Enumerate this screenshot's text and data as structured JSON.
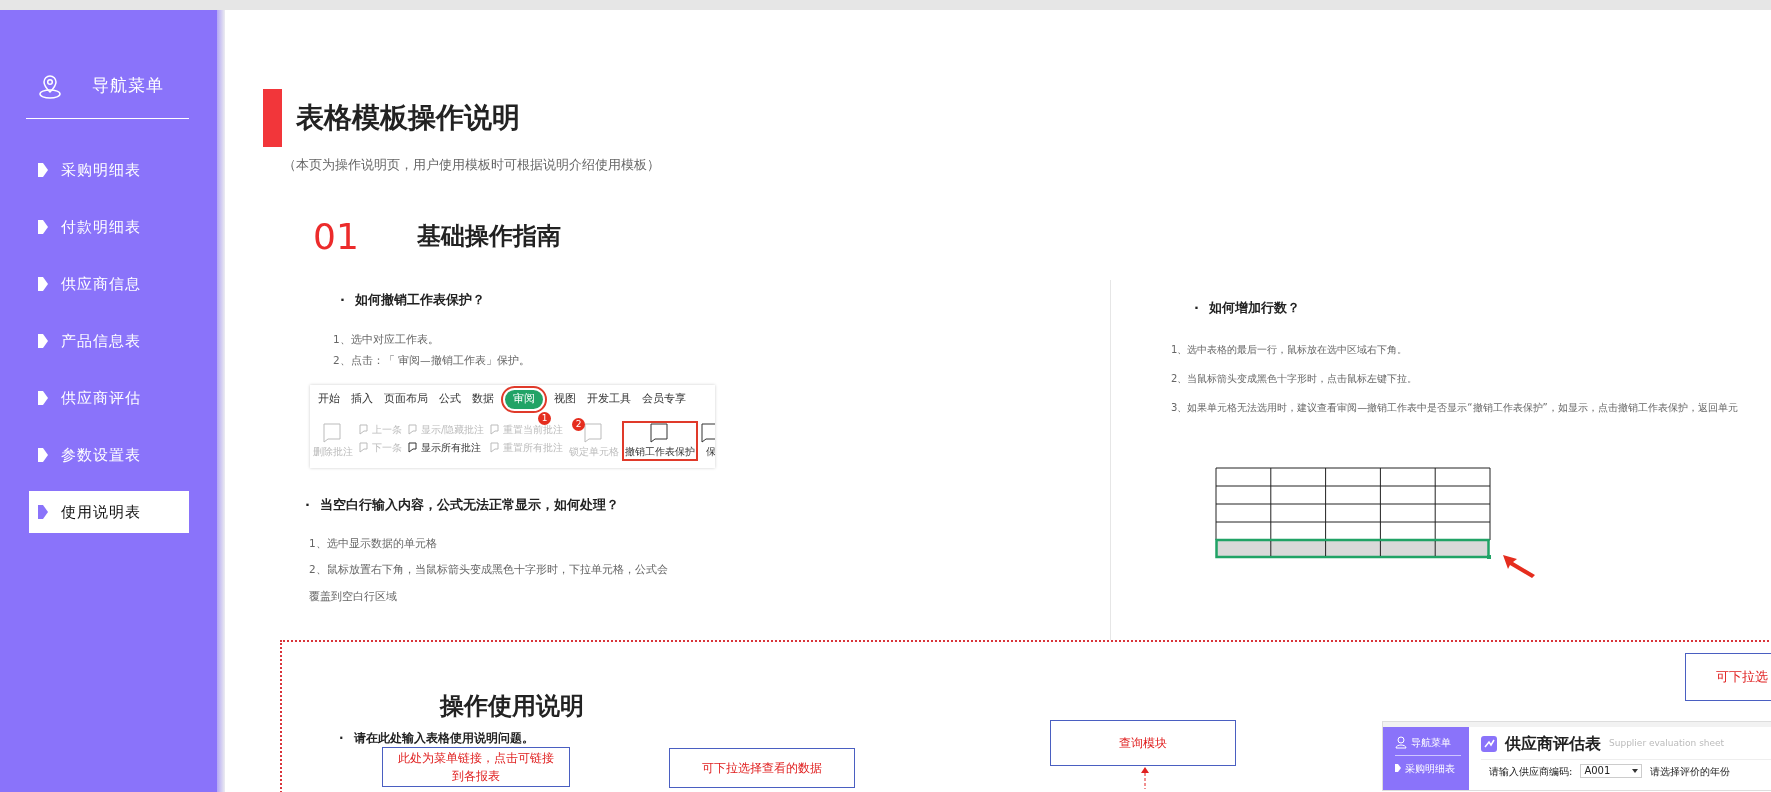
{
  "sidebar": {
    "title": "导航菜单",
    "items": [
      {
        "label": "采购明细表",
        "selected": false
      },
      {
        "label": "付款明细表",
        "selected": false
      },
      {
        "label": "供应商信息",
        "selected": false
      },
      {
        "label": "产品信息表",
        "selected": false
      },
      {
        "label": "供应商评估",
        "selected": false
      },
      {
        "label": "参数设置表",
        "selected": false
      },
      {
        "label": "使用说明表",
        "selected": true
      }
    ]
  },
  "page": {
    "title": "表格模板操作说明",
    "subtitle": "（本页为操作说明页，用户使用模板时可根据说明介绍使用模板）"
  },
  "section": {
    "number": "01",
    "title": "基础操作指南"
  },
  "left_column": {
    "faqs": [
      {
        "bullet": "·",
        "question": "如何撤销工作表保护？",
        "steps": [
          "1、选中对应工作表。",
          "2、点击：「 审阅—撤销工作表」保护。"
        ],
        "kind": "with_toolbar"
      },
      {
        "bullet": "·",
        "question": "当空白行输入内容，公式无法正常显示，如何处理？",
        "steps": [
          "1、选中显示数据的单元格",
          "2、鼠标放置右下角，当鼠标箭头变成黑色十字形时，下拉单元格，公式会覆盖到空白行区域"
        ],
        "kind": "plain"
      }
    ],
    "toolbar_image": {
      "tabs": [
        {
          "label": "开始",
          "selected": false
        },
        {
          "label": "插入",
          "selected": false
        },
        {
          "label": "页面布局",
          "selected": false
        },
        {
          "label": "公式",
          "selected": false
        },
        {
          "label": "数据",
          "selected": false
        },
        {
          "label": "审阅",
          "selected": true
        },
        {
          "label": "视图",
          "selected": false
        },
        {
          "label": "开发工具",
          "selected": false
        },
        {
          "label": "会员专享",
          "selected": false
        }
      ],
      "ribbon": [
        {
          "label": "删除批注",
          "kind": "large",
          "disabled": true,
          "highlighted": false
        },
        {
          "label": "上一条",
          "kind": "small",
          "disabled": true,
          "highlighted": false
        },
        {
          "label": "下一条",
          "kind": "small",
          "disabled": true,
          "highlighted": false
        },
        {
          "label": "显示/隐藏批注",
          "kind": "small",
          "disabled": true,
          "highlighted": false
        },
        {
          "label": "显示所有批注",
          "kind": "small",
          "disabled": false,
          "highlighted": false
        },
        {
          "label": "重置当前批注",
          "kind": "small",
          "disabled": true,
          "highlighted": false
        },
        {
          "label": "重置所有批注",
          "kind": "small",
          "disabled": true,
          "highlighted": false
        },
        {
          "label": "锁定单元格",
          "kind": "large",
          "disabled": true,
          "highlighted": false
        },
        {
          "label": "撤销工作表保护",
          "kind": "large",
          "disabled": false,
          "highlighted": true
        },
        {
          "label": "保",
          "kind": "large",
          "disabled": false,
          "highlighted": false
        }
      ],
      "markers": [
        "1",
        "2"
      ]
    }
  },
  "right_column": {
    "faqs": [
      {
        "bullet": "·",
        "question": "如何增加行数？",
        "steps": [
          "1、选中表格的最后一行，鼠标放在选中区域右下角。",
          "2、当鼠标箭头变成黑色十字形时，点击鼠标左键下拉。",
          "3、如果单元格无法选用时，建议查看审阅—撤销工作表中是否显示“撤销工作表保护”，如显示，点击撤销工作表保护，返回单元"
        ],
        "kind": "with_grid"
      }
    ]
  },
  "usage_panel": {
    "title": "操作使用说明",
    "bullet": "·",
    "prompt": "请在此处输入表格使用说明问题。",
    "callouts": [
      {
        "text": "可下拉选",
        "kind": "top_right"
      },
      {
        "text": "此处为菜单链接，点击可链接到各报表",
        "kind": "menu"
      },
      {
        "text": "可下拉选择查看的数据",
        "kind": "dropdown"
      },
      {
        "text": "查询模块",
        "kind": "query"
      }
    ],
    "preview": {
      "sidebar_title": "导航菜单",
      "sidebar_item": "采购明细表",
      "title": "供应商评估表",
      "subtitle": "Supplier evaluation sheet",
      "field_label": "请输入供应商编码:",
      "field_value": "A001",
      "field2_label": "请选择评价的年份"
    }
  }
}
